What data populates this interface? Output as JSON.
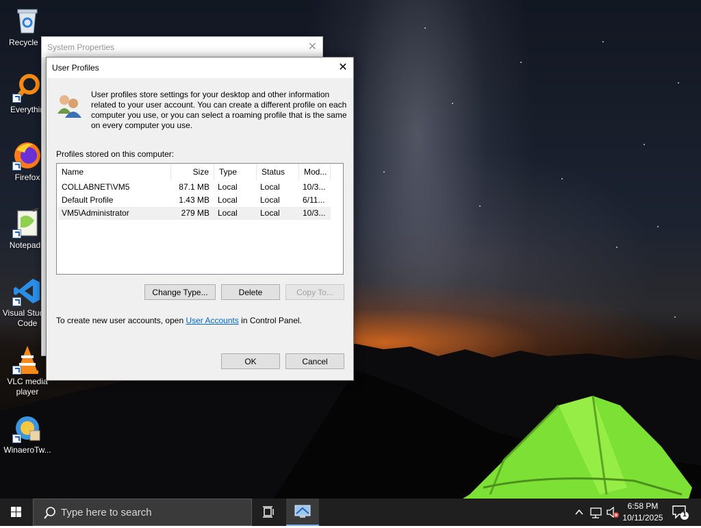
{
  "desktop": {
    "icons": [
      {
        "label": "Recycle B",
        "icon": "recycle-bin-icon"
      },
      {
        "label": "Everythin",
        "icon": "everything-search-icon"
      },
      {
        "label": "Firefox",
        "icon": "firefox-icon"
      },
      {
        "label": "Notepad+",
        "icon": "notepad-plus-plus-icon"
      },
      {
        "label": "Visual Stud… Code",
        "icon": "vscode-icon"
      },
      {
        "label": "VLC media player",
        "icon": "vlc-icon"
      },
      {
        "label": "WinaeroTw...",
        "icon": "winaero-tweaker-icon"
      }
    ]
  },
  "system_properties": {
    "title": "System Properties",
    "close_glyph": "✕"
  },
  "user_profiles": {
    "title": "User Profiles",
    "close_glyph": "✕",
    "info": "User profiles store settings for your desktop and other information related to your user account. You can create a different profile on each computer you use, or you can select a roaming profile that is the same on every computer you use.",
    "list_label": "Profiles stored on this computer:",
    "columns": [
      "Name",
      "Size",
      "Type",
      "Status",
      "Mod..."
    ],
    "rows": [
      {
        "name": "COLLABNET\\VM5",
        "size": "87.1 MB",
        "type": "Local",
        "status": "Local",
        "modified": "10/3..."
      },
      {
        "name": "Default Profile",
        "size": "1.43 MB",
        "type": "Local",
        "status": "Local",
        "modified": "6/11..."
      },
      {
        "name": "VM5\\Administrator",
        "size": "279 MB",
        "type": "Local",
        "status": "Local",
        "modified": "10/3..."
      }
    ],
    "buttons": {
      "change_type": "Change Type...",
      "delete": "Delete",
      "copy_to": "Copy To...",
      "ok": "OK",
      "cancel": "Cancel"
    },
    "footer": {
      "before": "To create new user accounts, open ",
      "link": "User Accounts",
      "after": " in Control Panel."
    }
  },
  "taskbar": {
    "search_placeholder": "Type here to search",
    "time": "6:58 PM",
    "date": "10/11/2025",
    "notification_count": "1",
    "accent": "#7aaef0"
  }
}
